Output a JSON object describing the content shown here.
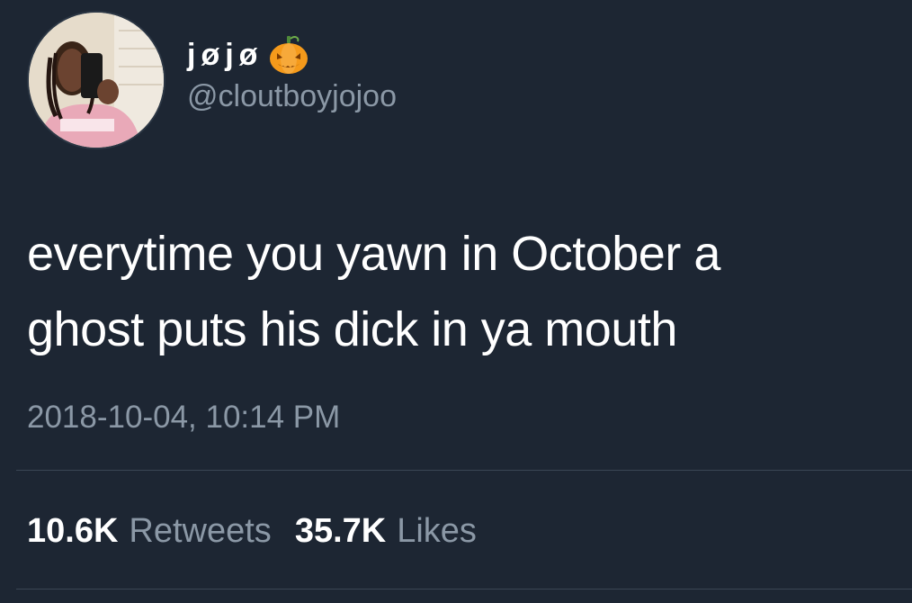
{
  "profile": {
    "display_name": "jøjø",
    "emoji_icon": "jack-o-lantern-icon",
    "handle": "@cloutboyjojoo"
  },
  "tweet": {
    "line1": "everytime you yawn in October a",
    "line2": "ghost puts his dick in ya mouth",
    "timestamp": "2018-10-04, 10:14 PM"
  },
  "stats": {
    "retweets_count": "10.6K",
    "retweets_label": "Retweets",
    "likes_count": "35.7K",
    "likes_label": "Likes"
  },
  "colors": {
    "background": "#1d2633",
    "secondary_text": "#8b98a6",
    "divider": "#3b4654"
  }
}
